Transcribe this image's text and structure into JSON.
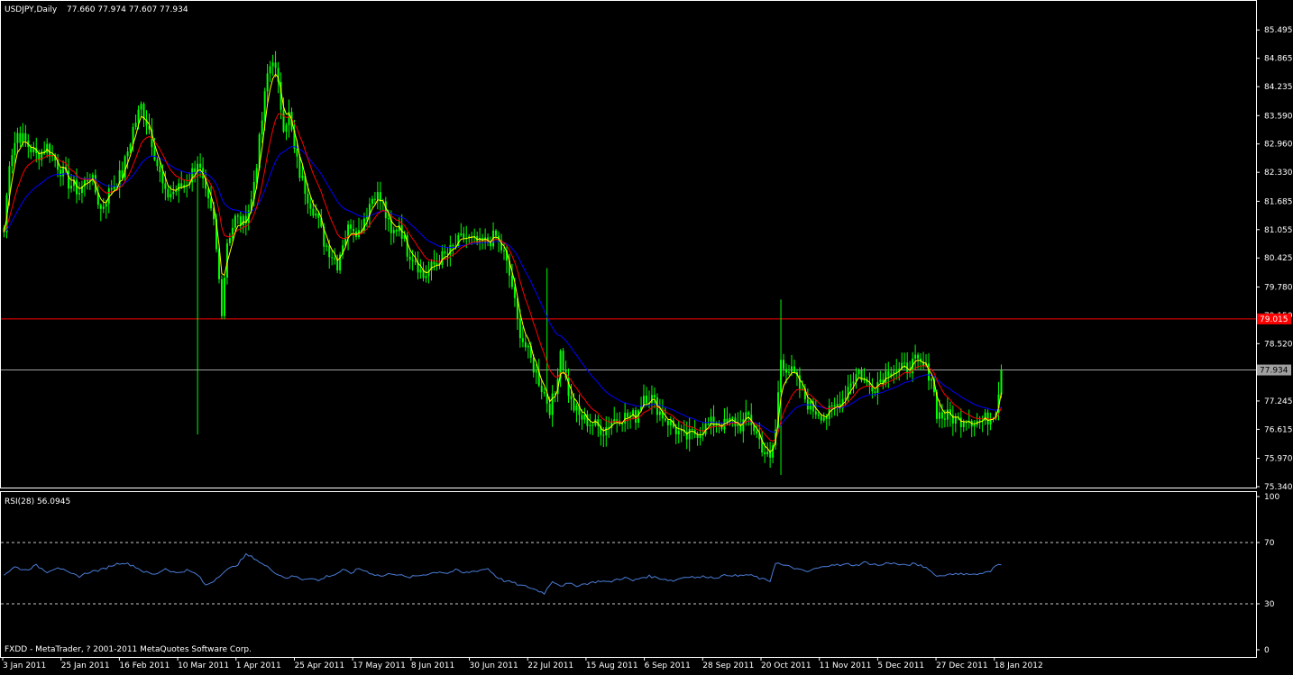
{
  "window": {
    "main_title": "USDJPY,Daily",
    "main_ohlc": "77.660 77.974 77.607 77.934",
    "rsi_title": "RSI(28) 56.0945",
    "footer": "FXDD - MetaTrader, ? 2001-2011 MetaQuotes Software Corp."
  },
  "colors": {
    "background": "#000000",
    "frame": "#ffffff",
    "candle": "#00ff00",
    "ma_fast": "#ffff00",
    "ma_mid": "#ff0000",
    "ma_slow": "#0000ff",
    "rsi_line": "#4a7cd6",
    "level_line": "#ff0000",
    "price_line": "#a0a0a0",
    "text": "#ffffff"
  },
  "chart_data": [
    {
      "type": "candlestick",
      "symbol": "USDJPY",
      "timeframe": "Daily",
      "ylim": [
        75.34,
        85.6
      ],
      "y_ticks": [
        "85.495",
        "84.865",
        "84.235",
        "83.590",
        "82.960",
        "82.330",
        "81.685",
        "81.055",
        "80.425",
        "79.780",
        "79.150",
        "78.520",
        "77.934",
        "77.245",
        "76.615",
        "75.970",
        "75.340"
      ],
      "x_ticks": [
        "3 Jan 2011",
        "25 Jan 2011",
        "16 Feb 2011",
        "10 Mar 2011",
        "1 Apr 2011",
        "25 Apr 2011",
        "17 May 2011",
        "8 Jun 2011",
        "30 Jun 2011",
        "22 Jul 2011",
        "15 Aug 2011",
        "6 Sep 2011",
        "28 Sep 2011",
        "20 Oct 2011",
        "11 Nov 2011",
        "5 Dec 2011",
        "27 Dec 2011",
        "18 Jan 2012"
      ],
      "horizontal_levels": [
        {
          "value": 79.07,
          "label": "79.015",
          "color": "#ff0000"
        },
        {
          "value": 77.934,
          "label": "77.934",
          "color": "#a0a0a0"
        }
      ],
      "close_path": [
        [
          0,
          81.0
        ],
        [
          2,
          82.6
        ],
        [
          5,
          83.2
        ],
        [
          8,
          83.0
        ],
        [
          12,
          82.7
        ],
        [
          16,
          82.9
        ],
        [
          20,
          82.5
        ],
        [
          24,
          82.1
        ],
        [
          28,
          81.9
        ],
        [
          32,
          82.3
        ],
        [
          36,
          81.5
        ],
        [
          40,
          82.0
        ],
        [
          44,
          82.3
        ],
        [
          48,
          83.3
        ],
        [
          51,
          83.8
        ],
        [
          54,
          83.3
        ],
        [
          57,
          82.5
        ],
        [
          60,
          81.8
        ],
        [
          63,
          81.9
        ],
        [
          66,
          82.0
        ],
        [
          69,
          82.2
        ],
        [
          72,
          82.6
        ],
        [
          75,
          81.8
        ],
        [
          78,
          81.2
        ],
        [
          81,
          79.3
        ],
        [
          83,
          80.8
        ],
        [
          86,
          81.3
        ],
        [
          89,
          81.2
        ],
        [
          92,
          81.7
        ],
        [
          95,
          83.0
        ],
        [
          98,
          84.5
        ],
        [
          100,
          84.9
        ],
        [
          102,
          84.2
        ],
        [
          104,
          83.4
        ],
        [
          106,
          83.6
        ],
        [
          108,
          82.8
        ],
        [
          110,
          82.3
        ],
        [
          113,
          81.8
        ],
        [
          116,
          81.4
        ],
        [
          119,
          80.8
        ],
        [
          122,
          80.5
        ],
        [
          124,
          80.3
        ],
        [
          126,
          80.8
        ],
        [
          129,
          81.2
        ],
        [
          132,
          81.0
        ],
        [
          135,
          81.5
        ],
        [
          138,
          81.9
        ],
        [
          141,
          81.6
        ],
        [
          144,
          80.9
        ],
        [
          147,
          81.2
        ],
        [
          150,
          80.6
        ],
        [
          153,
          80.4
        ],
        [
          156,
          80.0
        ],
        [
          159,
          80.2
        ],
        [
          162,
          80.4
        ],
        [
          165,
          80.5
        ],
        [
          168,
          80.7
        ],
        [
          171,
          80.9
        ],
        [
          174,
          80.8
        ],
        [
          177,
          80.7
        ],
        [
          180,
          80.8
        ],
        [
          183,
          80.9
        ],
        [
          186,
          80.5
        ],
        [
          189,
          79.8
        ],
        [
          191,
          79.0
        ],
        [
          193,
          78.6
        ],
        [
          195,
          78.3
        ],
        [
          197,
          78.0
        ],
        [
          199,
          77.7
        ],
        [
          201,
          77.4
        ],
        [
          203,
          77.1
        ],
        [
          205,
          77.4
        ],
        [
          207,
          78.4
        ],
        [
          209,
          77.7
        ],
        [
          211,
          77.2
        ],
        [
          214,
          76.9
        ],
        [
          217,
          76.8
        ],
        [
          220,
          76.7
        ],
        [
          223,
          76.6
        ],
        [
          226,
          76.8
        ],
        [
          229,
          76.9
        ],
        [
          232,
          76.9
        ],
        [
          235,
          76.9
        ],
        [
          238,
          77.4
        ],
        [
          241,
          77.3
        ],
        [
          244,
          77.0
        ],
        [
          247,
          76.8
        ],
        [
          250,
          76.6
        ],
        [
          253,
          76.4
        ],
        [
          256,
          76.5
        ],
        [
          259,
          76.6
        ],
        [
          262,
          76.7
        ],
        [
          265,
          76.8
        ],
        [
          268,
          76.7
        ],
        [
          271,
          76.8
        ],
        [
          274,
          76.7
        ],
        [
          277,
          76.9
        ],
        [
          280,
          76.5
        ],
        [
          283,
          76.1
        ],
        [
          285,
          75.9
        ],
        [
          287,
          76.6
        ],
        [
          289,
          78.2
        ],
        [
          291,
          78.0
        ],
        [
          294,
          77.8
        ],
        [
          297,
          77.4
        ],
        [
          300,
          77.1
        ],
        [
          303,
          77.0
        ],
        [
          306,
          76.9
        ],
        [
          309,
          77.1
        ],
        [
          312,
          77.3
        ],
        [
          315,
          77.7
        ],
        [
          318,
          77.9
        ],
        [
          321,
          77.6
        ],
        [
          324,
          77.6
        ],
        [
          327,
          77.8
        ],
        [
          330,
          78.0
        ],
        [
          333,
          77.9
        ],
        [
          336,
          78.0
        ],
        [
          339,
          78.1
        ],
        [
          342,
          78.0
        ],
        [
          345,
          77.8
        ],
        [
          347,
          77.0
        ],
        [
          349,
          76.9
        ],
        [
          352,
          76.9
        ],
        [
          355,
          76.8
        ],
        [
          358,
          76.9
        ],
        [
          361,
          76.8
        ],
        [
          364,
          76.8
        ],
        [
          367,
          76.9
        ],
        [
          369,
          77.1
        ],
        [
          371,
          77.934
        ]
      ],
      "anomaly_wicks": [
        {
          "bar": 72,
          "low": 76.5
        },
        {
          "bar": 202,
          "high": 80.2
        },
        {
          "bar": 289,
          "high": 79.5,
          "low": 75.6
        }
      ]
    },
    {
      "type": "line",
      "indicator": "RSI",
      "period": 28,
      "current": 56.0945,
      "ylim": [
        0,
        100
      ],
      "y_ticks": [
        "100",
        "70",
        "30",
        "0"
      ],
      "levels": [
        70,
        30
      ],
      "path": [
        [
          0,
          49
        ],
        [
          4,
          54
        ],
        [
          8,
          52
        ],
        [
          12,
          55
        ],
        [
          16,
          51
        ],
        [
          20,
          54
        ],
        [
          24,
          50
        ],
        [
          28,
          48
        ],
        [
          32,
          51
        ],
        [
          36,
          52
        ],
        [
          40,
          55
        ],
        [
          44,
          57
        ],
        [
          48,
          55
        ],
        [
          52,
          51
        ],
        [
          56,
          49
        ],
        [
          60,
          53
        ],
        [
          64,
          50
        ],
        [
          68,
          52
        ],
        [
          72,
          49
        ],
        [
          75,
          42
        ],
        [
          78,
          45
        ],
        [
          81,
          50
        ],
        [
          84,
          53
        ],
        [
          87,
          56
        ],
        [
          90,
          62
        ],
        [
          93,
          60
        ],
        [
          96,
          56
        ],
        [
          99,
          53
        ],
        [
          102,
          49
        ],
        [
          105,
          47
        ],
        [
          108,
          48
        ],
        [
          111,
          46
        ],
        [
          114,
          47
        ],
        [
          117,
          45
        ],
        [
          120,
          48
        ],
        [
          123,
          49
        ],
        [
          126,
          52
        ],
        [
          129,
          50
        ],
        [
          132,
          53
        ],
        [
          135,
          51
        ],
        [
          138,
          49
        ],
        [
          141,
          48
        ],
        [
          144,
          50
        ],
        [
          147,
          49
        ],
        [
          150,
          47
        ],
        [
          153,
          48
        ],
        [
          156,
          49
        ],
        [
          159,
          50
        ],
        [
          162,
          51
        ],
        [
          165,
          50
        ],
        [
          168,
          52
        ],
        [
          171,
          50
        ],
        [
          174,
          51
        ],
        [
          177,
          52
        ],
        [
          180,
          53
        ],
        [
          183,
          48
        ],
        [
          186,
          45
        ],
        [
          189,
          44
        ],
        [
          192,
          42
        ],
        [
          195,
          41
        ],
        [
          198,
          39
        ],
        [
          201,
          37
        ],
        [
          204,
          45
        ],
        [
          207,
          42
        ],
        [
          210,
          43
        ],
        [
          213,
          42
        ],
        [
          216,
          43
        ],
        [
          219,
          44
        ],
        [
          222,
          45
        ],
        [
          225,
          44
        ],
        [
          228,
          46
        ],
        [
          231,
          47
        ],
        [
          234,
          45
        ],
        [
          237,
          47
        ],
        [
          240,
          48
        ],
        [
          243,
          47
        ],
        [
          246,
          46
        ],
        [
          249,
          45
        ],
        [
          252,
          47
        ],
        [
          255,
          48
        ],
        [
          258,
          47
        ],
        [
          261,
          48
        ],
        [
          264,
          47
        ],
        [
          267,
          48
        ],
        [
          270,
          49
        ],
        [
          273,
          48
        ],
        [
          276,
          49
        ],
        [
          279,
          48
        ],
        [
          282,
          46
        ],
        [
          285,
          45
        ],
        [
          287,
          57
        ],
        [
          290,
          55
        ],
        [
          293,
          54
        ],
        [
          296,
          52
        ],
        [
          299,
          51
        ],
        [
          302,
          53
        ],
        [
          305,
          54
        ],
        [
          308,
          56
        ],
        [
          311,
          55
        ],
        [
          314,
          56
        ],
        [
          317,
          55
        ],
        [
          320,
          57
        ],
        [
          323,
          56
        ],
        [
          326,
          55
        ],
        [
          329,
          57
        ],
        [
          332,
          56
        ],
        [
          335,
          55
        ],
        [
          338,
          56
        ],
        [
          341,
          55
        ],
        [
          344,
          53
        ],
        [
          346,
          49
        ],
        [
          349,
          48
        ],
        [
          352,
          50
        ],
        [
          355,
          49
        ],
        [
          358,
          50
        ],
        [
          361,
          49
        ],
        [
          364,
          50
        ],
        [
          367,
          51
        ],
        [
          369,
          55
        ],
        [
          371,
          56.1
        ]
      ]
    }
  ]
}
